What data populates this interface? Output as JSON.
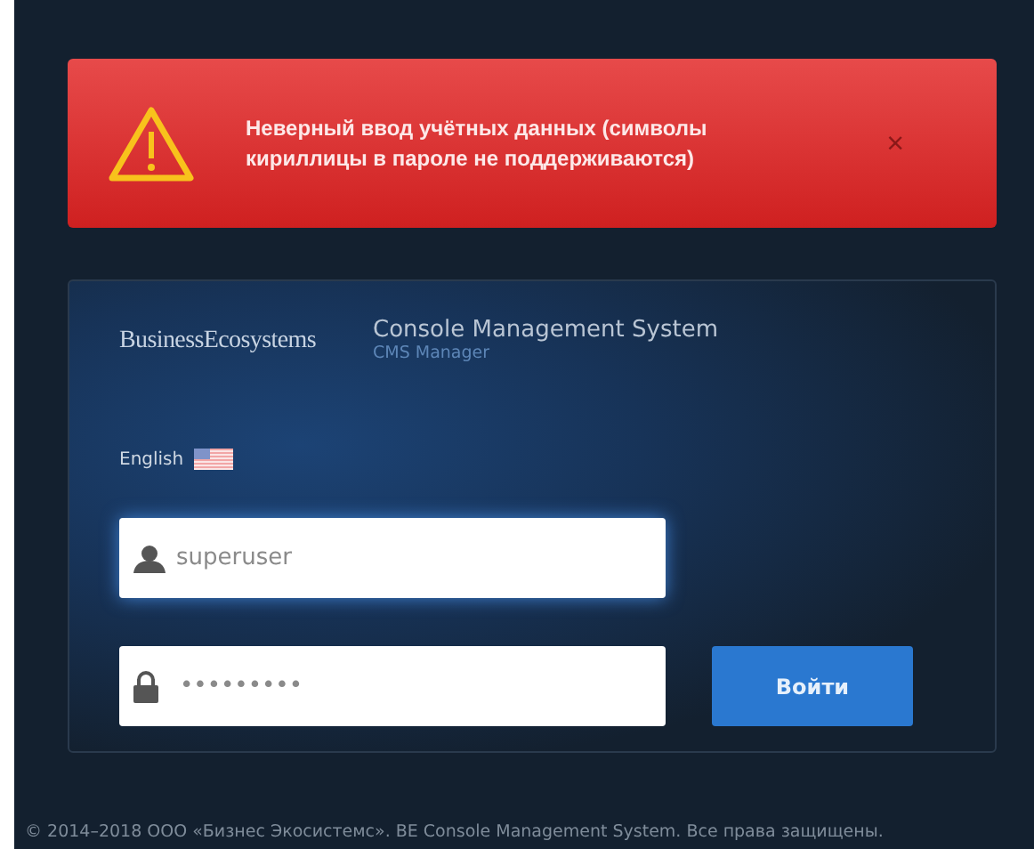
{
  "alert": {
    "message": "Неверный ввод учётных данных (символы кириллицы в пароле не поддерживаются)",
    "close": "×"
  },
  "header": {
    "brand": "BusinessEcosystems",
    "title": "Console Management System",
    "subtitle": "CMS Manager"
  },
  "language": {
    "label": "English"
  },
  "username": {
    "value": "superuser"
  },
  "password": {
    "value": "•••••••••"
  },
  "submit": "Войти",
  "footer": "© 2014–2018 ООО «Бизнес Экосистемс». BE Console Management System. Все права защищены."
}
